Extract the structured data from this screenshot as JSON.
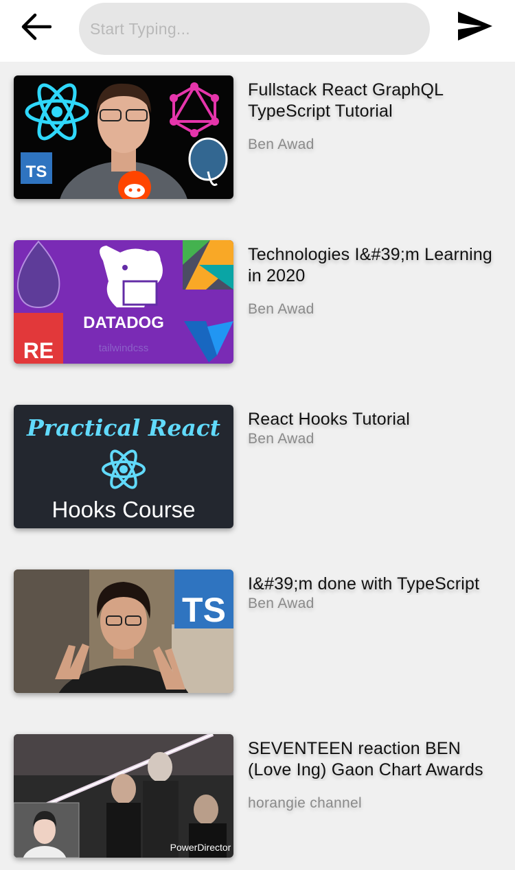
{
  "header": {
    "back_icon": "arrow-left-icon",
    "search_placeholder": "Start Typing...",
    "search_value": "",
    "send_icon": "send-icon"
  },
  "videos": [
    {
      "title": "Fullstack React GraphQL TypeScript Tutorial",
      "channel": "Ben Awad",
      "thumbnail": {
        "TS": "TS"
      }
    },
    {
      "title": "Technologies I&#39;m Learning in 2020",
      "channel": "Ben Awad",
      "thumbnail": {
        "brand": "DATADOG",
        "corner": "RE",
        "tag": "tailwindcss"
      }
    },
    {
      "title": "React Hooks Tutorial",
      "channel": "Ben Awad",
      "thumbnail": {
        "line1": "Practical React",
        "line2": "Hooks Course"
      }
    },
    {
      "title": "I&#39;m done with TypeScript",
      "channel": "Ben Awad",
      "thumbnail": {
        "badge": "TS"
      }
    },
    {
      "title": "SEVENTEEN reaction BEN (Love Ing) Gaon Chart Awards",
      "channel": "horangie channel",
      "thumbnail": {
        "watermark": "PowerDirector"
      }
    }
  ]
}
